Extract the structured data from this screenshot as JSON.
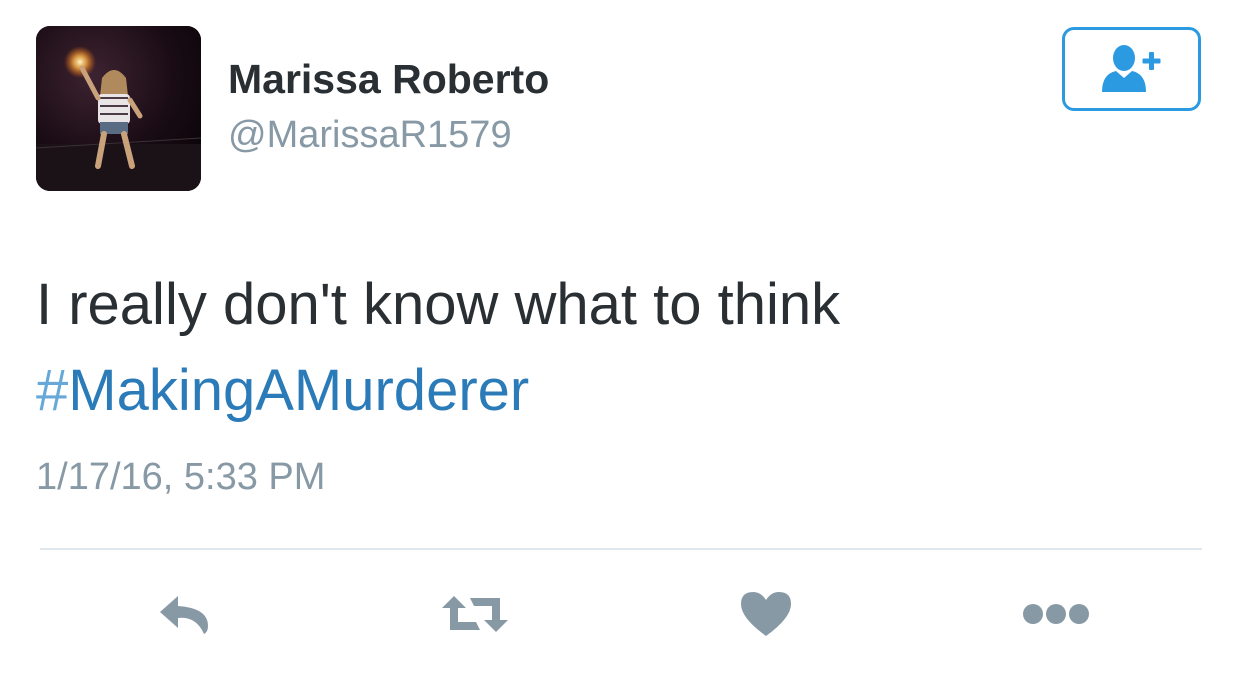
{
  "tweet": {
    "author": {
      "display_name": "Marissa Roberto",
      "handle": "@MarissaR1579"
    },
    "text": "I really don't know what to think",
    "hashtag": {
      "symbol": "#",
      "tag": "MakingAMurderer"
    },
    "timestamp": "1/17/16, 5:33 PM"
  },
  "icons": {
    "follow": "add-user-icon",
    "reply": "reply-icon",
    "retweet": "retweet-icon",
    "like": "heart-icon",
    "more": "more-icon"
  },
  "colors": {
    "text": "#292f33",
    "secondary": "#8899a6",
    "link": "#2b7bb9",
    "accent": "#2b9ae0",
    "action_icon": "#8899a6",
    "divider": "#e1e8ed"
  }
}
